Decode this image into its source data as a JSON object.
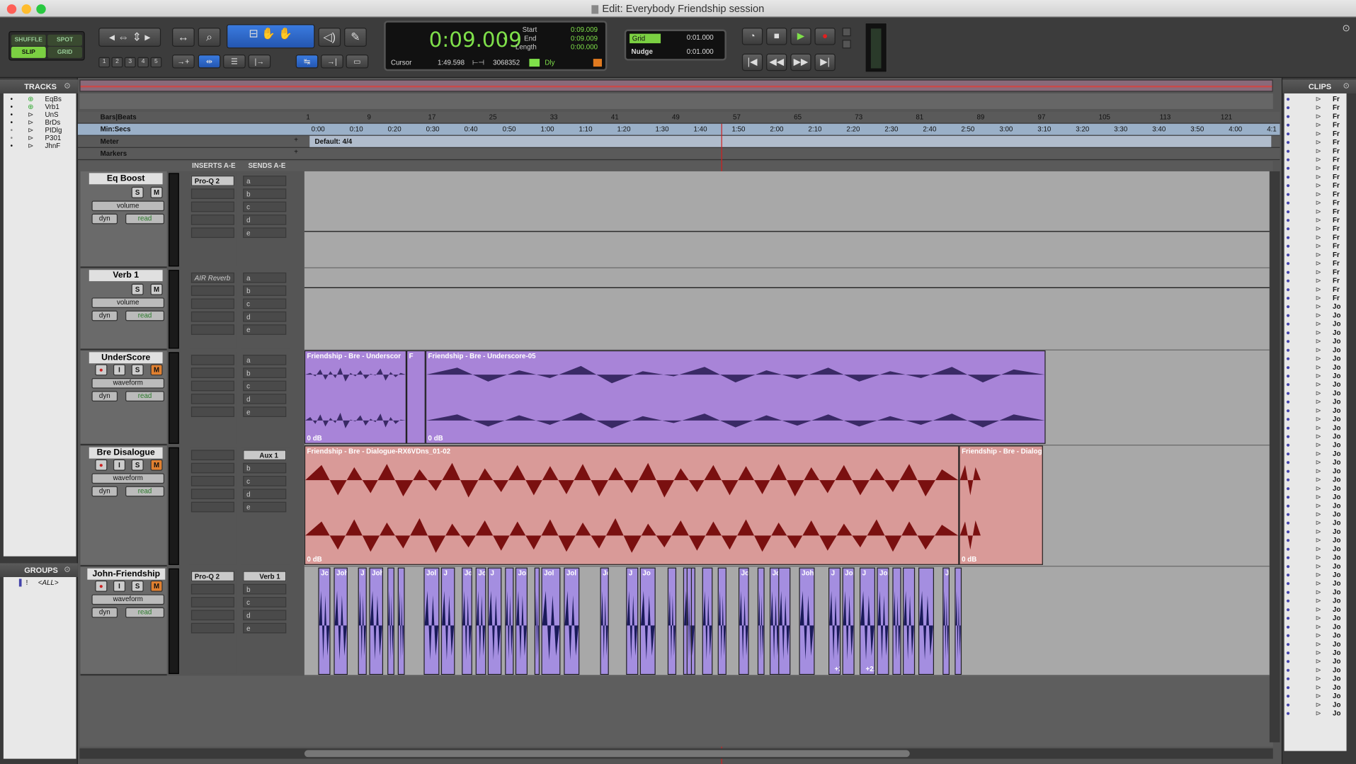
{
  "window": {
    "title": "Edit: Everybody Friendship session"
  },
  "modes": {
    "shuffle": "SHUFFLE",
    "spot": "SPOT",
    "slip": "SLIP",
    "grid": "GRID"
  },
  "zoom_presets": [
    "1",
    "2",
    "3",
    "4",
    "5"
  ],
  "counter": {
    "main": "0:09.009",
    "start_label": "Start",
    "start": "0:09.009",
    "end_label": "End",
    "end": "0:09.009",
    "length_label": "Length",
    "length": "0:00.000",
    "cursor_label": "Cursor",
    "cursor": "1:49.598",
    "samples": "3068352",
    "dly": "Dly"
  },
  "grid": {
    "grid_label": "Grid",
    "grid_value": "0:01.000",
    "nudge_label": "Nudge",
    "nudge_value": "0:01.000"
  },
  "panels": {
    "tracks": "TRACKS",
    "groups": "GROUPS",
    "clips": "CLIPS",
    "groups_all": "<ALL>"
  },
  "track_list": [
    "EqBs",
    "Vrb1",
    "UnS",
    "BrDs",
    "PIDlg",
    "P301",
    "JhnF"
  ],
  "rulers": {
    "bars_beats": "Bars|Beats",
    "min_secs": "Min:Secs",
    "meter": "Meter",
    "markers": "Markers",
    "meter_default": "Default: 4/4"
  },
  "bars_ticks": [
    "1",
    "9",
    "17",
    "25",
    "33",
    "41",
    "49",
    "57",
    "65",
    "73",
    "81",
    "89",
    "97",
    "105",
    "113",
    "121"
  ],
  "time_ticks": [
    "0:00",
    "0:10",
    "0:20",
    "0:30",
    "0:40",
    "0:50",
    "1:00",
    "1:10",
    "1:20",
    "1:30",
    "1:40",
    "1:50",
    "2:00",
    "2:10",
    "2:20",
    "2:30",
    "2:40",
    "2:50",
    "3:00",
    "3:10",
    "3:20",
    "3:30",
    "3:40",
    "3:50",
    "4:00",
    "4:1"
  ],
  "columns": {
    "inserts": "INSERTS A-E",
    "sends": "SENDS A-E"
  },
  "send_letters": [
    "a",
    "b",
    "c",
    "d",
    "e"
  ],
  "tracks": [
    {
      "name": "Eq Boost",
      "view": "volume",
      "dyn": "dyn",
      "auto": "read",
      "insert": "Pro-Q 2",
      "send": "",
      "has_record": false
    },
    {
      "name": "Verb 1",
      "view": "volume",
      "dyn": "dyn",
      "auto": "read",
      "insert": "AIR Reverb",
      "send": "",
      "has_record": false
    },
    {
      "name": "UnderScore",
      "view": "waveform",
      "dyn": "dyn",
      "auto": "read",
      "insert": "",
      "send": "",
      "has_record": true
    },
    {
      "name": "Bre Disalogue",
      "view": "waveform",
      "dyn": "dyn",
      "auto": "read",
      "insert": "",
      "send": "Aux 1",
      "has_record": true
    },
    {
      "name": "John-Friendship",
      "view": "waveform",
      "dyn": "dyn",
      "auto": "read",
      "insert": "Pro-Q 2",
      "send": "Verb 1",
      "has_record": true
    }
  ],
  "buttons": {
    "solo": "S",
    "mute": "M",
    "input": "I"
  },
  "clips": {
    "underscore_1": "Friendship - Bre - Underscor",
    "underscore_f": "F",
    "underscore_2": "Friendship - Bre - Underscore-05",
    "dialogue_1": "Friendship - Bre - Dialogue-RX6VDns_01-02",
    "dialogue_2": "Friendship - Bre - Dialog",
    "gain_0": "0 dB",
    "john_gain": "+2.6",
    "john_labels": [
      "Jc",
      "Joh",
      "J",
      "Joh",
      "Jol",
      "J",
      "John",
      "Jo",
      "J",
      "Jol",
      "Jol",
      "Jol",
      "Jo",
      "J",
      "Jo",
      "Jol",
      "John -",
      "John -",
      "J",
      "Joh",
      "J",
      "Joh",
      "Jc"
    ]
  },
  "clip_list": [
    "Fr",
    "Fr",
    "Fr",
    "Fr",
    "Fr",
    "Fr",
    "Fr",
    "Fr",
    "Fr",
    "Fr",
    "Fr",
    "Fr",
    "Fr",
    "Fr",
    "Fr",
    "Fr",
    "Fr",
    "Fr",
    "Fr",
    "Fr",
    "Fr",
    "Fr",
    "Fr",
    "Fr",
    "Jo",
    "Jo",
    "Jo",
    "Jo",
    "Jo",
    "Jo",
    "Jo",
    "Jo",
    "Jo",
    "Jo",
    "Jo",
    "Jo",
    "Jo",
    "Jo",
    "Jo",
    "Jo",
    "Jo",
    "Jo",
    "Jo",
    "Jo",
    "Jo",
    "Jo",
    "Jo",
    "Jo",
    "Jo",
    "Jo",
    "Jo",
    "Jo",
    "Jo",
    "Jo",
    "Jo",
    "Jo",
    "Jo",
    "Jo",
    "Jo",
    "Jo",
    "Jo",
    "Jo",
    "Jo",
    "Jo",
    "Jo",
    "Jo",
    "Jo",
    "Jo",
    "Jo",
    "Jo",
    "Jo",
    "Jo"
  ],
  "colors": {
    "underscore": "#a884d8",
    "dialogue": "#d99a98",
    "john": "#a48ee0",
    "accent": "#3a7be0",
    "playhead": "#d02020"
  }
}
